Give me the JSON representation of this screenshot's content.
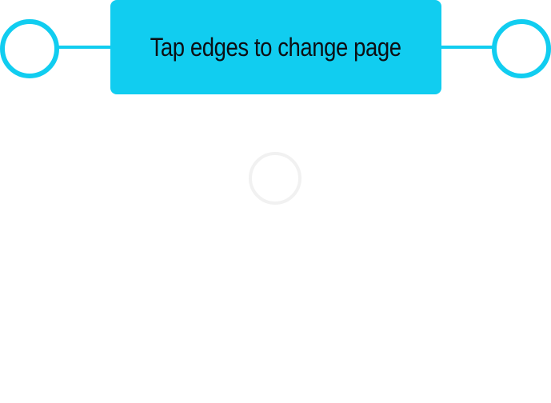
{
  "hint": {
    "text": "Tap edges to change page"
  },
  "colors": {
    "accent": "#11cdf0",
    "text": "#0c0f14",
    "spinner": "#f1f1f1",
    "background": "#ffffff"
  },
  "icons": {
    "left_edge": "circle-outline-icon",
    "right_edge": "circle-outline-icon",
    "loading": "loading-spinner-icon"
  }
}
